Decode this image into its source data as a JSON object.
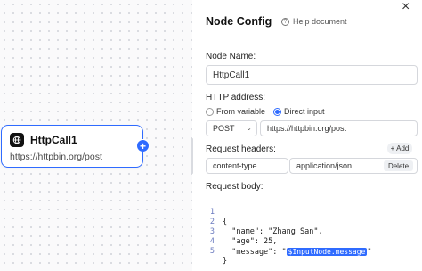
{
  "canvas": {
    "node": {
      "title": "HttpCall1",
      "url": "https://httpbin.org/post",
      "add_label": "+"
    }
  },
  "panel": {
    "title": "Node Config",
    "help_label": "Help document",
    "help_icon": "?",
    "close_label": "×",
    "node_name_label": "Node Name:",
    "node_name_value": "HttpCall1",
    "http_address_label": "HTTP address:",
    "address_options": [
      "From variable",
      "Direct input"
    ],
    "address_selected": "Direct input",
    "method_value": "POST",
    "method_chevron": "⌄",
    "url_value": "https://httpbin.org/post",
    "request_headers_label": "Request headers:",
    "add_button_label": "+ Add",
    "header_key": "content-type",
    "header_value": "application/json",
    "delete_button_label": "Delete",
    "request_body_label": "Request body:",
    "body_lines": [
      {
        "num": "1",
        "text": "{"
      },
      {
        "num": "2",
        "text": "  \"name\": \"Zhang San\","
      },
      {
        "num": "3",
        "text": "  \"age\": 25,"
      },
      {
        "num": "4",
        "text": "  \"message\": \"",
        "chip": "$InputNode.message",
        "after": "\""
      },
      {
        "num": "5",
        "text": "}"
      }
    ]
  },
  "colors": {
    "accent": "#2f6bff"
  }
}
